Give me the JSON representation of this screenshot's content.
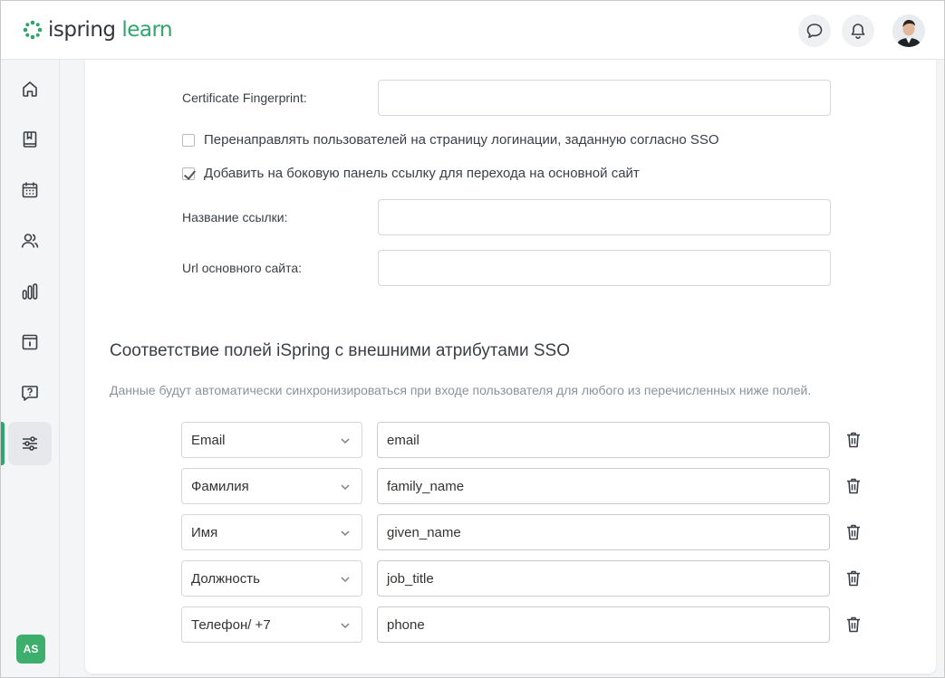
{
  "app": {
    "logo_main": "ispring",
    "logo_accent": "learn",
    "user_initials": "AS"
  },
  "header": {
    "icons": [
      "chat-icon",
      "bell-icon",
      "user-avatar"
    ]
  },
  "sidebar": {
    "items": [
      {
        "icon": "home-icon"
      },
      {
        "icon": "book-icon"
      },
      {
        "icon": "calendar-icon"
      },
      {
        "icon": "users-icon"
      },
      {
        "icon": "reports-icon"
      },
      {
        "icon": "info-icon"
      },
      {
        "icon": "help-icon"
      },
      {
        "icon": "settings-icon",
        "active": true
      }
    ]
  },
  "form": {
    "fingerprint_label": "Certificate Fingerprint:",
    "fingerprint_value": "",
    "redirect_checkbox_label": "Перенаправлять пользователей на страницу логинации, заданную согласно SSO",
    "redirect_checked": false,
    "sidebar_link_checkbox_label": "Добавить на боковую панель ссылку для перехода на основной сайт",
    "sidebar_link_checked": true,
    "link_name_label": "Название ссылки:",
    "link_name_value": "",
    "site_url_label": "Url основного сайта:",
    "site_url_value": ""
  },
  "mapping": {
    "title": "Соответствие полей iSpring с внешними атрибутами SSO",
    "description": "Данные будут автоматически синхронизироваться при входе пользователя для любого из перечисленных ниже полей.",
    "rows": [
      {
        "field": "Email",
        "attribute": "email"
      },
      {
        "field": "Фамилия",
        "attribute": "family_name"
      },
      {
        "field": "Имя",
        "attribute": "given_name"
      },
      {
        "field": "Должность",
        "attribute": "job_title"
      },
      {
        "field": "Телефон/ +7",
        "attribute": "phone"
      }
    ]
  },
  "colors": {
    "accent": "#2fa56b",
    "badge": "#3dae6c"
  }
}
